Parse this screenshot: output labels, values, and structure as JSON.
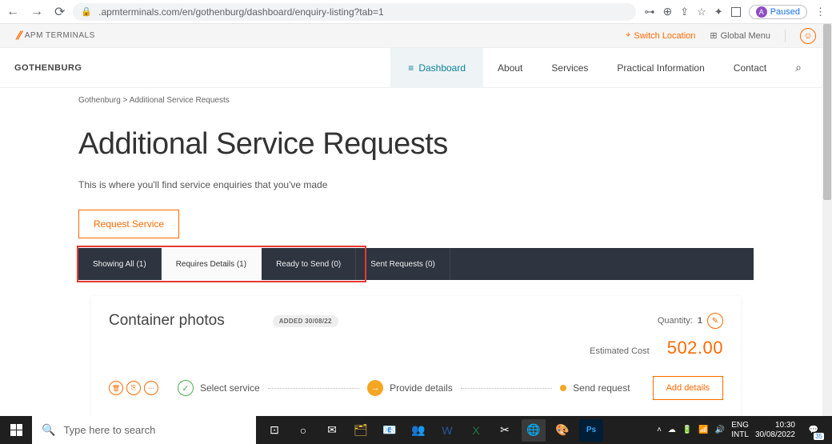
{
  "chrome": {
    "url": ".apmterminals.com/en/gothenburg/dashboard/enquiry-listing?tab=1",
    "paused_label": "Paused",
    "avatar_letter": "A"
  },
  "site": {
    "logo_text": "APM TERMINALS",
    "switch_location": "Switch Location",
    "global_menu": "Global Menu"
  },
  "nav": {
    "location": "GOTHENBURG",
    "dashboard": "Dashboard",
    "about": "About",
    "services": "Services",
    "practical": "Practical Information",
    "contact": "Contact"
  },
  "breadcrumb": {
    "root": "Gothenburg",
    "sep": " > ",
    "current": "Additional Service Requests"
  },
  "page": {
    "title": "Additional Service Requests",
    "subtitle": "This is where you'll find service enquiries that you've made",
    "request_button": "Request Service"
  },
  "tabs": {
    "all": "Showing All (1)",
    "requires": "Requires Details (1)",
    "ready": "Ready to Send (0)",
    "sent": "Sent Requests (0)"
  },
  "card": {
    "title": "Container photos",
    "added_badge": "ADDED 30/08/22",
    "quantity_label": "Quantity:",
    "quantity_value": "1",
    "cost_label": "Estimated Cost",
    "cost_value": "502.00",
    "step1": "Select service",
    "step2": "Provide details",
    "step3": "Send request",
    "add_details": "Add details"
  },
  "taskbar": {
    "search_placeholder": "Type here to search",
    "lang1": "ENG",
    "lang2": "INTL",
    "time": "10:30",
    "date": "30/08/2022",
    "notif_count": "35"
  }
}
